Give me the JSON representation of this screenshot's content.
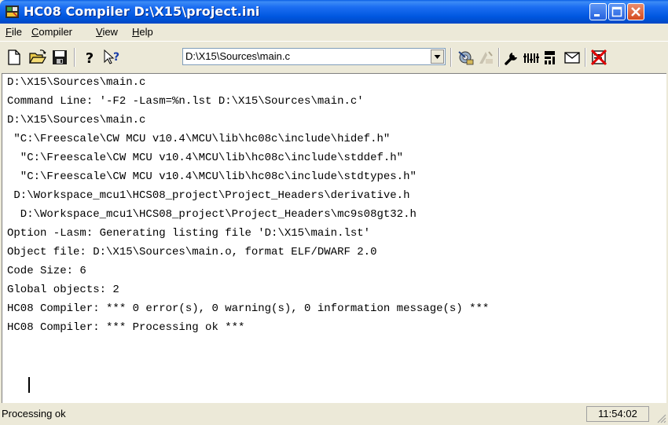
{
  "window": {
    "title": "HC08 Compiler  D:\\X15\\project.ini"
  },
  "menu": [
    {
      "key": "F",
      "rest": "ile"
    },
    {
      "key": "C",
      "rest": "ompiler"
    },
    {
      "key": "V",
      "rest": "iew"
    },
    {
      "key": "H",
      "rest": "elp"
    }
  ],
  "toolbar": {
    "file_combo_value": "D:\\X15\\Sources\\main.c",
    "icons": [
      "new-file-icon",
      "open-folder-icon",
      "save-icon",
      "help-icon",
      "context-help-icon",
      "compile-icon",
      "stop-icon",
      "options-icon",
      "settings-icon",
      "message-settings-icon",
      "mail-icon",
      "clear-icon"
    ]
  },
  "output": {
    "lines": [
      "D:\\X15\\Sources\\main.c",
      "Command Line: '-F2 -Lasm=%n.lst D:\\X15\\Sources\\main.c'",
      "D:\\X15\\Sources\\main.c",
      " \"C:\\Freescale\\CW MCU v10.4\\MCU\\lib\\hc08c\\include\\hidef.h\"",
      "  \"C:\\Freescale\\CW MCU v10.4\\MCU\\lib\\hc08c\\include\\stddef.h\"",
      "  \"C:\\Freescale\\CW MCU v10.4\\MCU\\lib\\hc08c\\include\\stdtypes.h\"",
      " D:\\Workspace_mcu1\\HCS08_project\\Project_Headers\\derivative.h",
      "  D:\\Workspace_mcu1\\HCS08_project\\Project_Headers\\mc9s08gt32.h",
      "Option -Lasm: Generating listing file 'D:\\X15\\main.lst'",
      "Object file: D:\\X15\\Sources\\main.o, format ELF/DWARF 2.0",
      "Code Size: 6",
      "Global objects: 2",
      "HC08 Compiler: *** 0 error(s), 0 warning(s), 0 information message(s) ***",
      "HC08 Compiler: *** Processing ok ***"
    ]
  },
  "status": {
    "message": "Processing ok",
    "time": "11:54:02"
  },
  "colors": {
    "titlebar": "#0058e6",
    "chrome": "#ece9d8",
    "close_button": "#d54a1e"
  }
}
